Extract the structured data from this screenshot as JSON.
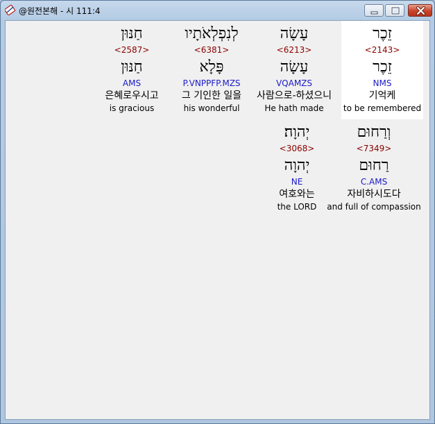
{
  "window": {
    "title": "@원전본해 - 시 111:4",
    "app_icon": "bible-book-icon",
    "minimize_icon": "minimize-icon",
    "maximize_icon": "maximize-icon",
    "close_icon": "close-icon"
  },
  "rows": [
    {
      "words": [
        {
          "hebrew": "זֵכֶר",
          "strong": "<2143>",
          "lemma": "זֵכֶר",
          "morph": "NMS",
          "korean": "기억케",
          "english": "to be remembered",
          "highlighted": true
        },
        {
          "hebrew": "עָשָׂה",
          "strong": "<6213>",
          "lemma": "עָשָׂה",
          "morph": "VQAMZS",
          "korean": "사람으로-하셨으니",
          "english": "He hath made",
          "highlighted": false
        },
        {
          "hebrew": "לְנִפְלְאֹתָיו",
          "strong": "<6381>",
          "lemma": "פָּלָא",
          "morph": "P.VNPPFP.MZS",
          "korean": "그 기인한 일을",
          "english": "his wonderful",
          "highlighted": false
        },
        {
          "hebrew": "חַנּוּן",
          "strong": "<2587>",
          "lemma": "חַנּוּן",
          "morph": "AMS",
          "korean": "은혜로우시고",
          "english": "is gracious",
          "highlighted": false
        }
      ]
    },
    {
      "words": [
        {
          "hebrew": "וְרַחוּם",
          "strong": "<7349>",
          "lemma": "רַחוּם",
          "morph": "C.AMS",
          "korean": "자비하시도다",
          "english": "and full of compassion",
          "highlighted": false
        },
        {
          "hebrew": "יְהוָה׃",
          "strong": "<3068>",
          "lemma": "יְהוָה",
          "morph": "NE",
          "korean": "여호와는",
          "english": "the LORD",
          "highlighted": false
        }
      ]
    }
  ]
}
